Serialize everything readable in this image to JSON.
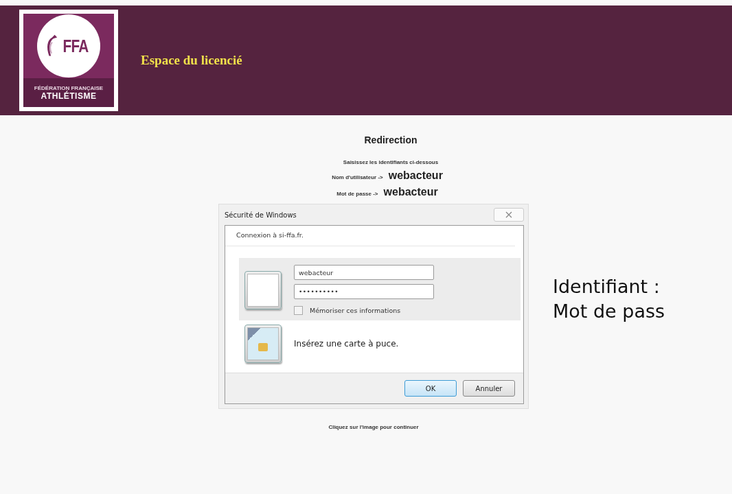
{
  "header": {
    "logo": {
      "mark": "FFA",
      "line_1": "FÉDÉRATION FRANÇAISE",
      "line_2": "ATHLÉTISME"
    },
    "title": "Espace du licencié"
  },
  "redirect": {
    "heading": "Redirection",
    "instruction": "Saisissez les identifiants ci-dessous",
    "credentials": [
      {
        "label": "Nom d'utilisateur ->",
        "value": "webacteur"
      },
      {
        "label": "Mot de passe ->",
        "value": "webacteur"
      }
    ],
    "footer": "Cliquez sur l'image pour continuer"
  },
  "dialog": {
    "title": "Sécurité de Windows",
    "subtitle": "Connexion à si-ffa.fr.",
    "username": {
      "value": "webacteur"
    },
    "password": {
      "value": "••••••••••"
    },
    "remember": {
      "label": "Mémoriser ces informations",
      "checked": false
    },
    "smartcard": "Insérez une carte à puce.",
    "buttons": [
      {
        "label": "OK",
        "default": true
      },
      {
        "label": "Annuler",
        "default": false
      }
    ]
  },
  "side_text": [
    "Identifiant :",
    "Mot de pass"
  ]
}
